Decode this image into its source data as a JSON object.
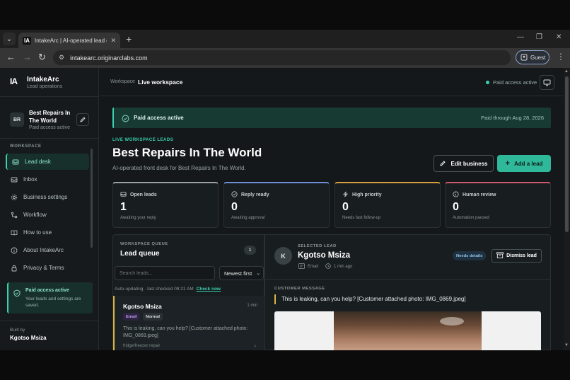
{
  "browser": {
    "tab_title": "IntakeArc | AI-operated lead de",
    "favicon_text": "IA",
    "url": "intakearc.originarclabs.com",
    "profile": "Guest"
  },
  "sidebar": {
    "logo": "IA",
    "brand": "IntakeArc",
    "brand_sub": "Lead operations",
    "business": {
      "initials": "BR",
      "name": "Best Repairs In The World",
      "status": "Paid access active"
    },
    "section_label": "WORKSPACE",
    "items": [
      {
        "label": "Lead desk",
        "icon": "inbox-tray-icon",
        "active": true
      },
      {
        "label": "Inbox",
        "icon": "inbox-icon",
        "active": false
      },
      {
        "label": "Business settings",
        "icon": "gear-icon",
        "active": false
      },
      {
        "label": "Workflow",
        "icon": "workflow-icon",
        "active": false
      },
      {
        "label": "How to use",
        "icon": "book-icon",
        "active": false
      },
      {
        "label": "About IntakeArc",
        "icon": "info-icon",
        "active": false
      },
      {
        "label": "Privacy & Terms",
        "icon": "lock-icon",
        "active": false
      }
    ],
    "paid_card": {
      "title": "Paid access active",
      "desc": "Your leads and settings are saved."
    },
    "built_by_label": "Built by",
    "built_by": "Kgotso Msiza"
  },
  "topbar": {
    "workspace_label": "Workspace",
    "workspace_name": "Live workspace",
    "status": "Paid access active"
  },
  "banner": {
    "text": "Paid access active",
    "right": "Paid through Aug 28, 2026"
  },
  "header": {
    "eyebrow": "LIVE WORKSPACE LEADS",
    "title": "Best Repairs In The World",
    "subtitle": "AI-operated front desk for Best Repairs In The World.",
    "edit_label": "Edit business",
    "add_label": "Add a lead"
  },
  "stats": [
    {
      "label": "Open leads",
      "value": "1",
      "hint": "Awaiting your reply",
      "color": "#9aa3a1",
      "icon": "inbox-icon"
    },
    {
      "label": "Reply ready",
      "value": "0",
      "hint": "Awaiting approval",
      "color": "#6d8fd6",
      "icon": "check-circle-icon"
    },
    {
      "label": "High priority",
      "value": "0",
      "hint": "Needs fast follow-up",
      "color": "#d8a13e",
      "icon": "bolt-icon"
    },
    {
      "label": "Human review",
      "value": "0",
      "hint": "Automation paused",
      "color": "#d0596a",
      "icon": "info-icon"
    }
  ],
  "queue": {
    "eyebrow": "WORKSPACE QUEUE",
    "title": "Lead queue",
    "count": "1",
    "search_placeholder": "Search leads...",
    "sort": "Newest first",
    "auto_update": "Auto-updating · last checked 09:21 AM",
    "check_now": "Check now",
    "lead": {
      "name": "Kgotso Msiza",
      "time": "1 min",
      "tags": [
        "Email",
        "Normal"
      ],
      "message": "This is leaking, can you help? [Customer attached photo: IMG_0869.jpeg]",
      "category": "fridge/freezer repair"
    }
  },
  "detail": {
    "avatar": "K",
    "eyebrow": "SELECTED LEAD",
    "name": "Kgotso Msiza",
    "channel": "Email",
    "time": "1 min ago",
    "badge": "Needs details",
    "dismiss_label": "Dismiss lead",
    "message_label": "CUSTOMER MESSAGE",
    "message": "This is leaking, can you help? [Customer attached photo: IMG_0869.jpeg]"
  }
}
